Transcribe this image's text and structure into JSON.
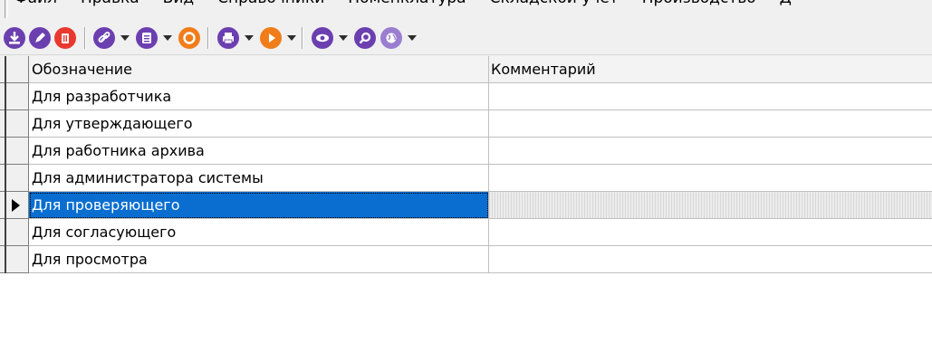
{
  "menu": {
    "items": [
      "Файл",
      "Правка",
      "Вид",
      "Справочники",
      "Номенклатура",
      "Складской учет",
      "Производство",
      "Д"
    ]
  },
  "toolbar": {
    "buttons": [
      {
        "icon": "download-icon",
        "color": "#6b3fb0"
      },
      {
        "icon": "edit-icon",
        "color": "#6b3fb0"
      },
      {
        "icon": "delete-icon",
        "color": "#e8382f"
      },
      {
        "icon": "link-icon",
        "color": "#6b3fb0"
      },
      {
        "icon": "list-icon",
        "color": "#6b3fb0"
      },
      {
        "icon": "refresh-icon",
        "color": "#f07d1a"
      },
      {
        "icon": "print-icon",
        "color": "#6b3fb0"
      },
      {
        "icon": "play-icon",
        "color": "#f07d1a"
      },
      {
        "icon": "eye-icon",
        "color": "#6b3fb0"
      },
      {
        "icon": "search-icon",
        "color": "#6b3fb0"
      },
      {
        "icon": "globe-icon",
        "color": "#6b3fb0"
      }
    ]
  },
  "grid": {
    "columns": [
      "Обозначение",
      "Комментарий"
    ],
    "rows": [
      {
        "name": "Для разработчика",
        "comment": ""
      },
      {
        "name": "Для утверждающего",
        "comment": ""
      },
      {
        "name": "Для работника архива",
        "comment": ""
      },
      {
        "name": "Для администратора системы",
        "comment": ""
      },
      {
        "name": "Для проверяющего",
        "comment": "",
        "selected": true
      },
      {
        "name": "Для согласующего",
        "comment": ""
      },
      {
        "name": "Для просмотра",
        "comment": ""
      }
    ],
    "selection_color": "#0a6ed1"
  }
}
